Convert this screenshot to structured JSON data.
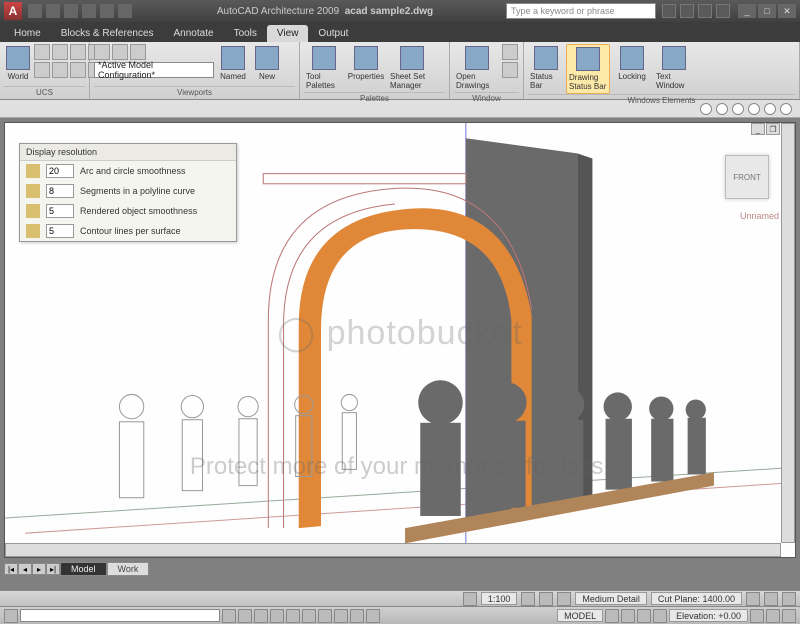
{
  "app": {
    "logo": "A",
    "title_prefix": "AutoCAD Architecture 2009",
    "filename": "acad sample2.dwg",
    "search_placeholder": "Type a keyword or phrase"
  },
  "menu": {
    "tabs": [
      "Home",
      "Blocks & References",
      "Annotate",
      "Tools",
      "View",
      "Output"
    ],
    "active": "View"
  },
  "ribbon": {
    "panels": [
      {
        "title": "UCS",
        "items": [
          {
            "label": "World"
          }
        ]
      },
      {
        "title": "Viewports",
        "config": "*Active Model Configuration*",
        "items": [
          {
            "label": "Named"
          },
          {
            "label": "New"
          }
        ]
      },
      {
        "title": "Palettes",
        "items": [
          {
            "label": "Tool Palettes"
          },
          {
            "label": "Properties"
          },
          {
            "label": "Sheet Set Manager"
          }
        ]
      },
      {
        "title": "Window",
        "items": [
          {
            "label": "Open Drawings"
          }
        ]
      },
      {
        "title": "Windows Elements",
        "items": [
          {
            "label": "Status Bar"
          },
          {
            "label": "Drawing Status Bar",
            "active": true
          },
          {
            "label": "Locking"
          },
          {
            "label": "Text Window"
          }
        ]
      }
    ]
  },
  "display_resolution": {
    "header": "Display resolution",
    "rows": [
      {
        "value": "20",
        "label": "Arc and circle smoothness"
      },
      {
        "value": "8",
        "label": "Segments in a polyline curve"
      },
      {
        "value": "5",
        "label": "Rendered object smoothness"
      },
      {
        "value": "5",
        "label": "Contour lines per surface"
      }
    ]
  },
  "viewcube": {
    "face": "FRONT"
  },
  "viewport": {
    "unnamed": "Unnamed"
  },
  "watermark": {
    "logo": "photobucket",
    "text": "Protect more of your memories for less!"
  },
  "bottom_tabs": {
    "active": "Model",
    "other": "Work"
  },
  "status_top": {
    "scale": "1:100",
    "detail": "Medium Detail",
    "cutplane_label": "Cut Plane:",
    "cutplane_value": "1400.00"
  },
  "status_bottom": {
    "space": "MODEL",
    "elev_label": "Elevation:",
    "elev_value": "+0.00"
  }
}
